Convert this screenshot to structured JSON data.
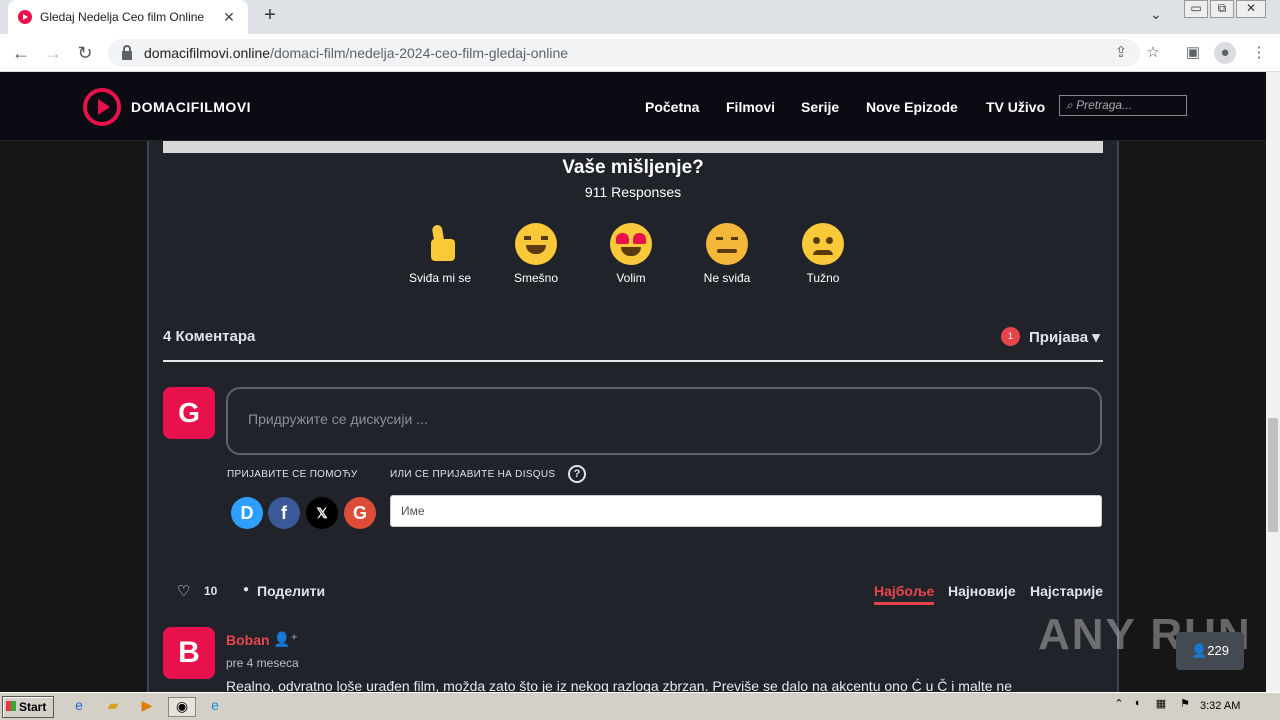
{
  "browser": {
    "tab_title": "Gledaj Nedelja Ceo film Online",
    "tab_close": "✕",
    "new_tab": "+",
    "tab_dropdown": "⌄",
    "url_host": "domacifilmovi.online",
    "url_path": "/domaci-film/nedelja-2024-ceo-film-gledaj-online",
    "window_controls": [
      "▭",
      "⧉",
      "✕"
    ]
  },
  "site": {
    "logo_text": "DOMACIFILMOVI",
    "nav": [
      "Početna",
      "Filmovi",
      "Serije",
      "Nove Epizode",
      "TV Uživo"
    ],
    "search_placeholder": "Pretraga..."
  },
  "reactions": {
    "title": "Vaše mišljenje?",
    "responses": "911 Responses",
    "items": [
      {
        "label": "Sviđa mi se",
        "icon": "thumbs-up-icon"
      },
      {
        "label": "Smešno",
        "icon": "laughing-face-icon"
      },
      {
        "label": "Volim",
        "icon": "heart-eyes-icon"
      },
      {
        "label": "Ne sviđa",
        "icon": "angry-face-icon"
      },
      {
        "label": "Tužno",
        "icon": "sad-face-icon"
      }
    ]
  },
  "comments": {
    "count_label": "4 Коментара",
    "notification_count": "1",
    "login_label": "Пријава ▾",
    "avatar_letter": "G",
    "input_placeholder": "Придружите се дискусији ...",
    "login_with": "ПРИЈАВИТЕ СЕ ПОМОЋУ",
    "or_disqus": "ИЛИ СЕ ПРИЈАВИТЕ НА DISQUS",
    "help": "?",
    "social": [
      "D",
      "f",
      "𝕏",
      "G"
    ],
    "name_placeholder": "Име",
    "likes": "10",
    "share": "Поделити",
    "sort": [
      "Најбоље",
      "Најновије",
      "Најстарије"
    ],
    "first": {
      "avatar": "B",
      "user": "Boban",
      "ago": "pre 4 meseca",
      "text": "Realno, odvratno loše urađen film, možda zato što je iz nekog razloga zbrzan. Previše se dalo na akcentu ono Ć u Č i malte ne"
    }
  },
  "overlay": {
    "online_count": "229",
    "watermark": "ANY RUN"
  },
  "taskbar": {
    "start": "Start",
    "time": "3:32 AM"
  },
  "colors": {
    "accent": "#e8114b",
    "page_bg": "#202329"
  }
}
